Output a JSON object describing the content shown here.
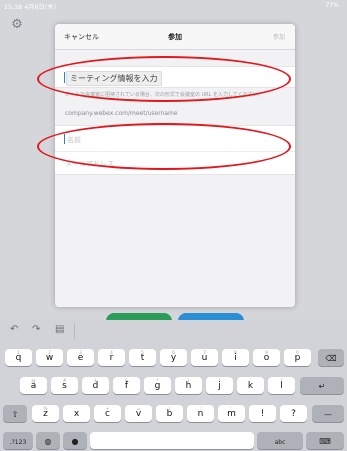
{
  "status_bar": {
    "time": "15:38  4月6日(木)",
    "battery": "77%"
  },
  "modal": {
    "cancel": "キャンセル",
    "title": "参加",
    "join": "参加",
    "meeting_info_label": "ミーティング情報を入力",
    "hint": "メールで会議室に招待されている場合、次の形式で会議室の URL を入力してください。",
    "url_example": "company.webex.com/meet/username",
    "name_placeholder": "名前",
    "email_placeholder": "メールアドレス"
  },
  "icons": {
    "settings": "gear-icon",
    "undo": "undo-icon",
    "redo": "redo-icon",
    "paste": "clipboard-icon",
    "backspace": "backspace-icon",
    "return": "return-icon",
    "shift": "shift-icon",
    "globe": "globe-icon",
    "mic": "mic-icon",
    "keyboard_dismiss": "keyboard-dismiss-icon"
  },
  "keyboard": {
    "row1": [
      {
        "main": "q",
        "alt": "1"
      },
      {
        "main": "w",
        "alt": "2"
      },
      {
        "main": "e",
        "alt": "3"
      },
      {
        "main": "r",
        "alt": "4"
      },
      {
        "main": "t",
        "alt": "5"
      },
      {
        "main": "y",
        "alt": "6"
      },
      {
        "main": "u",
        "alt": "7"
      },
      {
        "main": "i",
        "alt": "8"
      },
      {
        "main": "o",
        "alt": "9"
      },
      {
        "main": "p",
        "alt": "0"
      }
    ],
    "row2": [
      {
        "main": "a",
        "alt": "@"
      },
      {
        "main": "s",
        "alt": "#"
      },
      {
        "main": "d",
        "alt": "$"
      },
      {
        "main": "f",
        "alt": "&"
      },
      {
        "main": "g",
        "alt": "*"
      },
      {
        "main": "h",
        "alt": "("
      },
      {
        "main": "j",
        "alt": ")"
      },
      {
        "main": "k",
        "alt": "'"
      },
      {
        "main": "l",
        "alt": "\""
      }
    ],
    "row3": [
      {
        "main": "z",
        "alt": "%"
      },
      {
        "main": "x",
        "alt": "-"
      },
      {
        "main": "c",
        "alt": "+"
      },
      {
        "main": "v",
        "alt": "="
      },
      {
        "main": "b",
        "alt": "/"
      },
      {
        "main": "n",
        "alt": ";"
      },
      {
        "main": "m",
        "alt": ":"
      },
      {
        "main": "!",
        "alt": ","
      },
      {
        "main": "?",
        "alt": "."
      }
    ],
    "numbers_key": ".?123",
    "abc_key": "abc",
    "minus_key": "—"
  },
  "colors": {
    "annotation": "#e0191e",
    "accent_green": "#2c9d58",
    "accent_blue": "#2a8ed6"
  }
}
